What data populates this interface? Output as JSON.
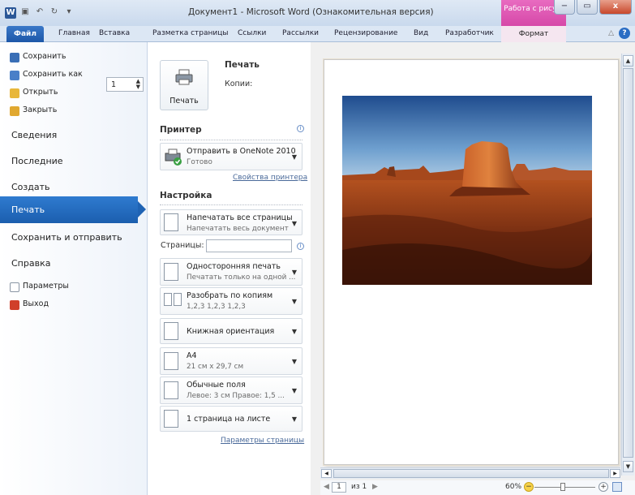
{
  "window": {
    "app_icon": "W",
    "title": "Документ1 - Microsoft Word (Ознакомительная версия)",
    "context_group": "Работа с рису...",
    "buttons": {
      "minimize": "−",
      "maximize": "▭",
      "close": "x"
    }
  },
  "ribbon": {
    "file_tab": "Файл",
    "tabs": [
      "Главная",
      "Вставка",
      "Разметка страницы",
      "Ссылки",
      "Рассылки",
      "Рецензирование",
      "Вид",
      "Разработчик"
    ],
    "context_tab": "Формат",
    "help": "?"
  },
  "backstage": {
    "top_items": [
      "Сохранить",
      "Сохранить как",
      "Открыть",
      "Закрыть"
    ],
    "sections": [
      "Сведения",
      "Последние",
      "Создать"
    ],
    "selected": "Печать",
    "sections2": [
      "Сохранить и отправить",
      "Справка"
    ],
    "bottom_items": [
      "Параметры",
      "Выход"
    ]
  },
  "print": {
    "button_label": "Печать",
    "heading": "Печать",
    "copies_label": "Копии:",
    "copies_value": "1",
    "printer_heading": "Принтер",
    "printer_name": "Отправить в OneNote 2010",
    "printer_status": "Готово",
    "printer_properties": "Свойства принтера",
    "settings_heading": "Настройка",
    "pages_label": "Страницы:",
    "page_setup_link": "Параметры страницы",
    "options": [
      {
        "t1": "Напечатать все страницы",
        "t2": "Напечатать весь документ"
      },
      {
        "t1": "Односторонняя печать",
        "t2": "Печатать только на одной ..."
      },
      {
        "t1": "Разобрать по копиям",
        "t2": "1,2,3   1,2,3   1,2,3"
      },
      {
        "t1": "Книжная ориентация",
        "t2": ""
      },
      {
        "t1": "A4",
        "t2": "21 см x 29,7 см"
      },
      {
        "t1": "Обычные поля",
        "t2": "Левое: 3 см   Правое: 1,5 ..."
      },
      {
        "t1": "1 страница на листе",
        "t2": ""
      }
    ]
  },
  "status": {
    "page": "1",
    "of": "из 1",
    "zoom": "60%"
  }
}
